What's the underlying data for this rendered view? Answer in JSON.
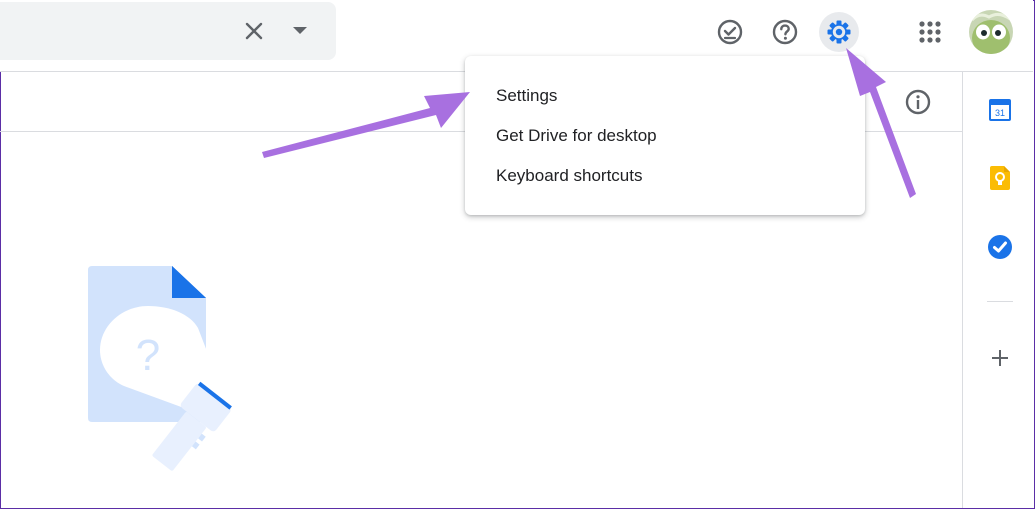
{
  "search": {
    "clear_icon": "close-icon",
    "options_icon": "caret-down-icon"
  },
  "header": {
    "buttons": [
      {
        "name": "ready-for-offline-icon"
      },
      {
        "name": "help-icon"
      },
      {
        "name": "settings-gear-icon",
        "active": true
      },
      {
        "name": "apps-grid-icon"
      },
      {
        "name": "account-avatar"
      }
    ]
  },
  "settings_menu": {
    "items": [
      {
        "label": "Settings"
      },
      {
        "label": "Get Drive for desktop"
      },
      {
        "label": "Keyboard shortcuts"
      }
    ]
  },
  "side_panel": {
    "calendar_day": "31",
    "items": [
      "calendar-icon",
      "keep-icon",
      "tasks-icon",
      "add-icon"
    ]
  },
  "colors": {
    "accent": "#1a73e8",
    "annotation_arrow": "#a870e0",
    "illustration_light": "#d2e3fc"
  }
}
